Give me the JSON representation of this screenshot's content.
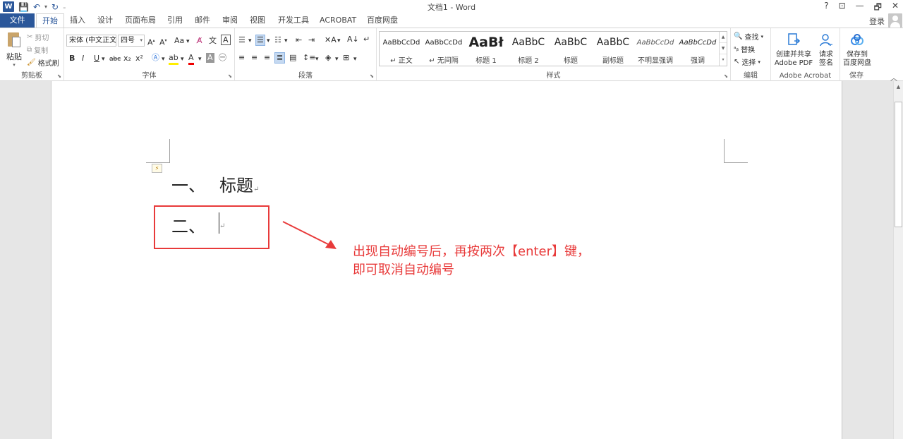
{
  "window": {
    "title": "文档1 - Word",
    "controls": [
      "?",
      "⊡",
      "—",
      "🗗",
      "✕"
    ]
  },
  "tabs": [
    {
      "label": "文件"
    },
    {
      "label": "开始"
    },
    {
      "label": "插入"
    },
    {
      "label": "设计"
    },
    {
      "label": "页面布局"
    },
    {
      "label": "引用"
    },
    {
      "label": "邮件"
    },
    {
      "label": "审阅"
    },
    {
      "label": "视图"
    },
    {
      "label": "开发工具"
    },
    {
      "label": "ACROBAT"
    },
    {
      "label": "百度网盘"
    }
  ],
  "account": {
    "login": "登录"
  },
  "clipboard": {
    "label": "剪贴板",
    "paste": "粘贴",
    "cut": "剪切",
    "copy": "复制",
    "format_painter": "格式刷"
  },
  "font": {
    "label": "字体",
    "font_name": "宋体 (中文正文)",
    "font_size": "四号",
    "change_case": "Aa",
    "bold": "B",
    "italic": "I",
    "underline": "U",
    "strikethrough": "abc",
    "subscript": "x₂",
    "superscript": "x²"
  },
  "paragraph": {
    "label": "段落"
  },
  "styles": {
    "label": "样式",
    "items": [
      {
        "sample": "AaBbCcDd",
        "name": "正文"
      },
      {
        "sample": "AaBbCcDd",
        "name": "无间隔"
      },
      {
        "sample": "AaBł",
        "name": "标题 1"
      },
      {
        "sample": "AaBbC",
        "name": "标题 2"
      },
      {
        "sample": "AaBbC",
        "name": "标题"
      },
      {
        "sample": "AaBbC",
        "name": "副标题"
      },
      {
        "sample": "AaBbCcDd",
        "name": "不明显强调"
      },
      {
        "sample": "AaBbCcDd",
        "name": "强调"
      }
    ]
  },
  "editing": {
    "label": "编辑",
    "find": "查找",
    "replace": "替换",
    "select": "选择"
  },
  "acrobat": {
    "label": "Adobe Acrobat",
    "create_line1": "创建并共享",
    "create_line2": "Adobe PDF",
    "sign_line1": "请求",
    "sign_line2": "签名"
  },
  "save_group": {
    "label": "保存",
    "save_line1": "保存到",
    "save_line2": "百度网盘"
  },
  "document": {
    "lines": [
      {
        "number": "一、",
        "text": "标题"
      },
      {
        "number": "二、",
        "text": ""
      }
    ],
    "pilcrow": "↵"
  },
  "annotation": {
    "line1": "出现自动编号后，再按两次【enter】键，",
    "line2": "即可取消自动编号",
    "color": "#e83a3a"
  },
  "colors": {
    "accent": "#2b579a",
    "annotation_red": "#e83a3a"
  }
}
